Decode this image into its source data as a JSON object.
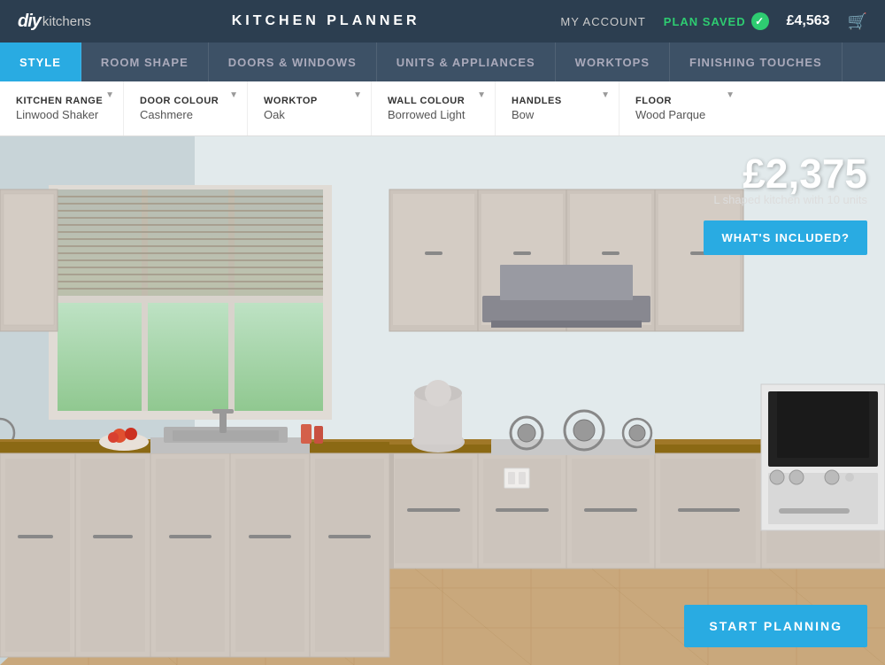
{
  "header": {
    "logo_diy": "diy",
    "logo_kitchens": "kitchens",
    "title": "KITCHEN PLANNER",
    "my_account": "MY ACCOUNT",
    "plan_saved": "PLAN SAVED",
    "price": "£4,563",
    "cart_icon": "🛒"
  },
  "nav": {
    "tabs": [
      {
        "id": "style",
        "label": "STYLE",
        "active": true
      },
      {
        "id": "room-shape",
        "label": "ROOM SHAPE",
        "active": false
      },
      {
        "id": "doors-windows",
        "label": "DOORS & WINDOWS",
        "active": false
      },
      {
        "id": "units-appliances",
        "label": "UNITS & APPLIANCES",
        "active": false
      },
      {
        "id": "worktops",
        "label": "WORKTOPS",
        "active": false
      },
      {
        "id": "finishing-touches",
        "label": "FINISHING TOUCHES",
        "active": false
      }
    ]
  },
  "style_bar": {
    "options": [
      {
        "id": "kitchen-range",
        "label": "KITCHEN RANGE",
        "value": "Linwood Shaker"
      },
      {
        "id": "door-colour",
        "label": "DOOR COLOUR",
        "value": "Cashmere"
      },
      {
        "id": "worktop",
        "label": "WORKTOP",
        "value": "Oak"
      },
      {
        "id": "wall-colour",
        "label": "WALL COLOUR",
        "value": "Borrowed Light"
      },
      {
        "id": "handles",
        "label": "HANDLES",
        "value": "Bow"
      },
      {
        "id": "floor",
        "label": "FLOOR",
        "value": "Wood Parque"
      }
    ]
  },
  "kitchen_view": {
    "price": "£2,375",
    "description": "L shaped kitchen with 10 units",
    "whats_included_label": "WHAT'S INCLUDED?",
    "start_planning_label": "START PLANNING"
  },
  "colors": {
    "active_tab": "#29abe2",
    "header_bg": "#2c3e50",
    "nav_bg": "#3d5166",
    "cabinet": "#d4ccc4",
    "worktop": "#8B6914",
    "wall": "#e2eaec",
    "plan_saved": "#2ecc71"
  }
}
